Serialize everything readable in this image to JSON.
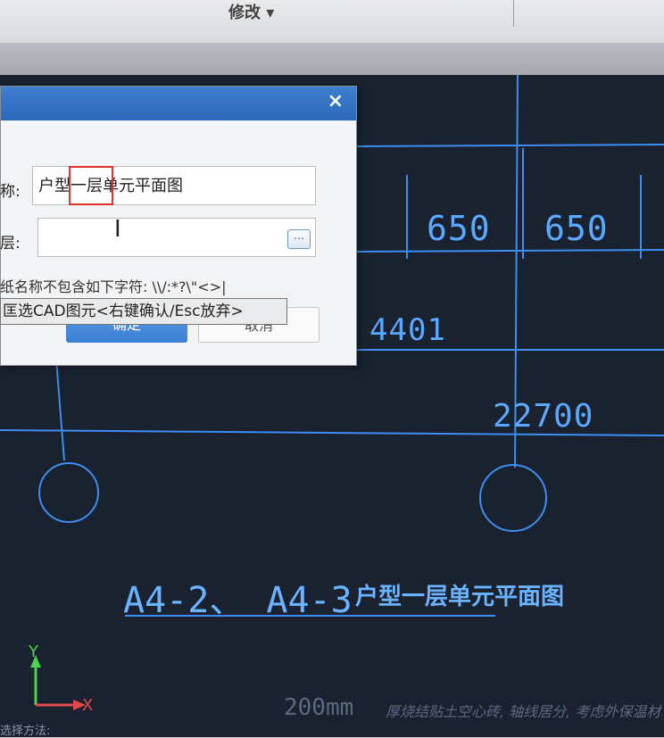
{
  "app": {
    "toolbar_label": "修改 ▾"
  },
  "dialog": {
    "close_symbol": "×",
    "name_label": "称:",
    "name_value": "户型一层单元平面图",
    "floor_label": "层:",
    "floor_value": "",
    "browse_symbol": "⋯",
    "hint_text": "纸名称不包含如下字符: \\\\/:*?\\\"<>|",
    "ok_label": "确定",
    "cancel_label": "取消"
  },
  "tooltip": {
    "text": "匡选CAD图元<右键确认/Esc放弃>"
  },
  "drawing": {
    "dim_650_a": "650",
    "dim_650_b": "650",
    "dim_4401": "4401",
    "dim_22700": "22700",
    "drawing_title_prefix": "A4-2、 A4-3",
    "drawing_title_name": "户型一层单元平面图",
    "scale_text": "200mm",
    "note_text": "厚烧结贴土空心砖, 轴线居分, 考虑外保温材料",
    "axis_y_label": "Y",
    "axis_x_label": "X",
    "footer_text": "选择方法:"
  },
  "colors": {
    "canvas_bg": "#1a2230",
    "cad_line": "#3d8ef0",
    "dialog_title": "#2b68b8",
    "highlight_box": "#e03030",
    "arrow": "#2f7fe0"
  }
}
